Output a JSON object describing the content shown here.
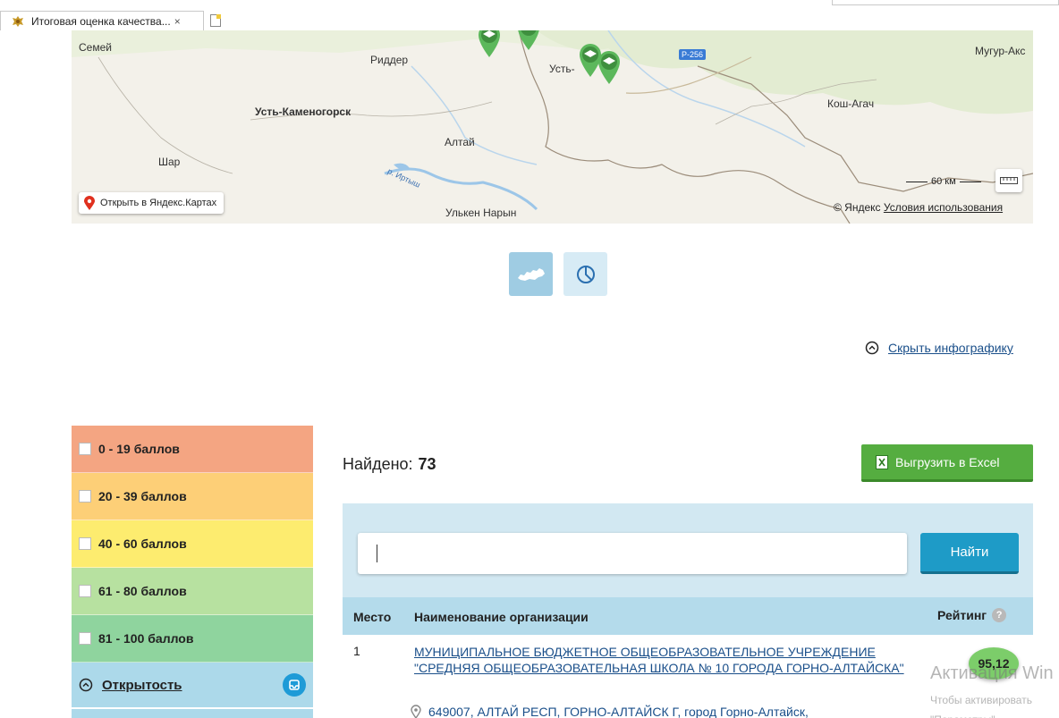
{
  "browser": {
    "tab_title": "Итоговая оценка качества...",
    "tab_close": "×",
    "tab_icon": "crest-icon",
    "new_tab_icon": "new-tab-icon"
  },
  "map": {
    "labels": {
      "semey": "Семей",
      "ridder": "Риддер",
      "ust": "Усть-",
      "road": "P-256",
      "mugur": "Мугур-Акс",
      "ust_kamenogorsk": "Усть-Каменогорск",
      "kosh_agach": "Кош-Агач",
      "altai": "Алтай",
      "shar": "Шар",
      "irtysh": "р. Иртыш",
      "ulken_naryn": "Улькен Нарын"
    },
    "open_button": "Открыть в Яндекс.Картах",
    "scale": "60 км",
    "copyright": "© Яндекс",
    "terms_link": "Условия использования",
    "marker_color": "#5cb85c"
  },
  "view_toggle": {
    "map_icon": "russia-map-icon",
    "chart_icon": "pie-chart-icon"
  },
  "hide_infographic": "Скрыть инфографику",
  "filters": [
    {
      "label": "0 - 19 баллов",
      "color": "#f4a582"
    },
    {
      "label": "20 - 39 баллов",
      "color": "#fdcf77"
    },
    {
      "label": "40 - 60 баллов",
      "color": "#fdec6f"
    },
    {
      "label": "61 - 80 баллов",
      "color": "#b7e1a0"
    },
    {
      "label": "81 - 100 баллов",
      "color": "#8fd49e"
    }
  ],
  "openness": {
    "label": "Открытость"
  },
  "found": {
    "label": "Найдено:",
    "count": "73"
  },
  "excel_button": "Выгрузить в Excel",
  "search": {
    "value": "",
    "button": "Найти"
  },
  "table": {
    "headers": {
      "place": "Место",
      "name": "Наименование организации",
      "rating": "Рейтинг"
    },
    "rows": [
      {
        "place": "1",
        "name": "МУНИЦИПАЛЬНОЕ БЮДЖЕТНОЕ ОБЩЕОБРАЗОВАТЕЛЬНОЕ УЧРЕЖДЕНИЕ \"СРЕДНЯЯ ОБЩЕОБРАЗОВАТЕЛЬНАЯ ШКОЛА № 10 ГОРОДА ГОРНО-АЛТАЙСКА\"",
        "address": "649007, АЛТАЙ РЕСП, ГОРНО-АЛТАЙСК Г, город Горно-Алтайск,",
        "score": "95,12",
        "score_color": "#7ccd6a"
      }
    ]
  },
  "windows_overlay": {
    "title": "Активация Win",
    "line1": "Чтобы активировать",
    "line2": "\"Параметры\""
  }
}
